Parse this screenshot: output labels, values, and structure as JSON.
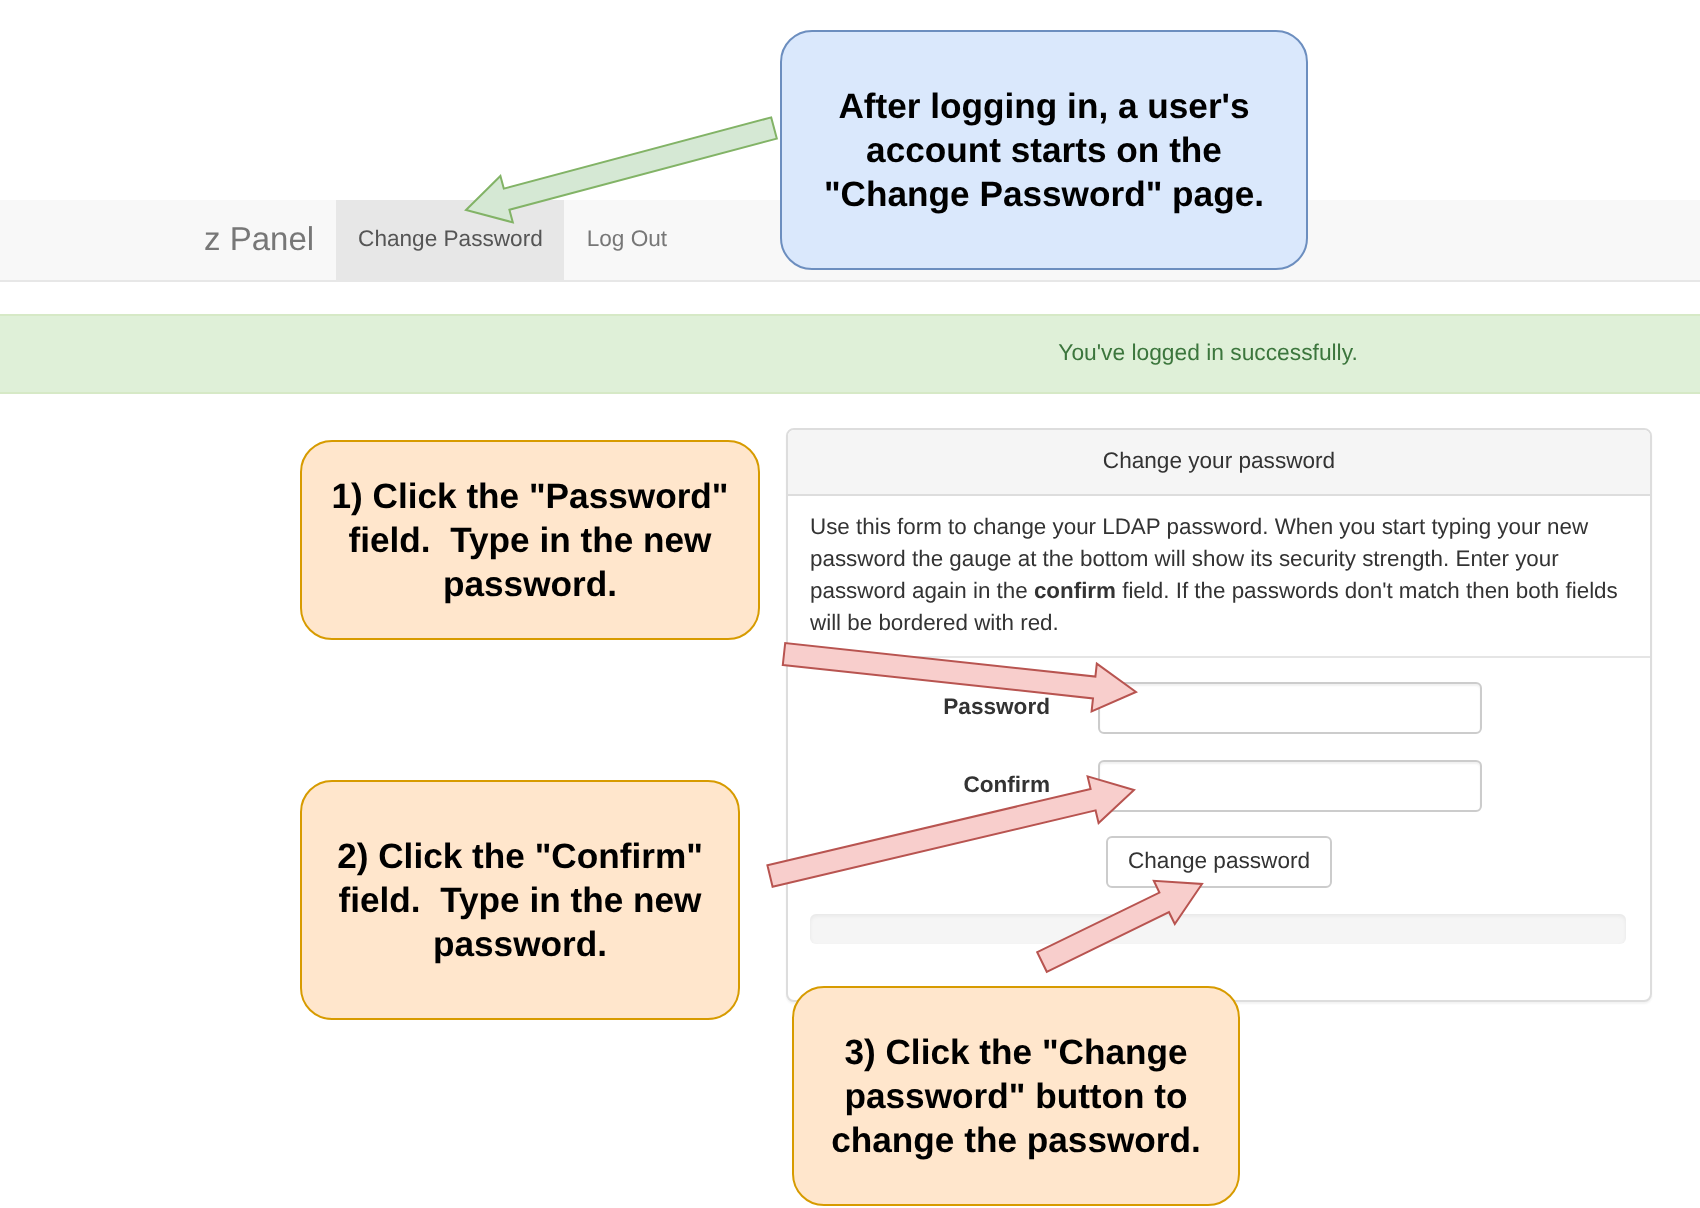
{
  "navbar": {
    "brand": "z Panel",
    "items": [
      {
        "label": "Change Password",
        "selected": true
      },
      {
        "label": "Log Out",
        "selected": false
      }
    ]
  },
  "alert": {
    "message": "You've logged in successfully."
  },
  "card": {
    "title": "Change your password",
    "description": "Use this form to change your LDAP password. When you start typing your new password the gauge at the bottom will show its security strength. Enter your password again in the **confirm** field. If the passwords don't match then both fields will be bordered with red.",
    "fields": [
      {
        "label": "Password"
      },
      {
        "label": "Confirm"
      }
    ],
    "button": "Change password"
  },
  "annotations": [
    {
      "kind": "note",
      "text": "After logging in, a user's account starts on the \"Change Password\" page."
    },
    {
      "kind": "step",
      "text": "1) Click the \"Password\" field.  Type in the new password."
    },
    {
      "kind": "step",
      "text": "2) Click the \"Confirm\" field.  Type in the new password."
    },
    {
      "kind": "step",
      "text": "3) Click the \"Change password\" button to change the password."
    }
  ]
}
